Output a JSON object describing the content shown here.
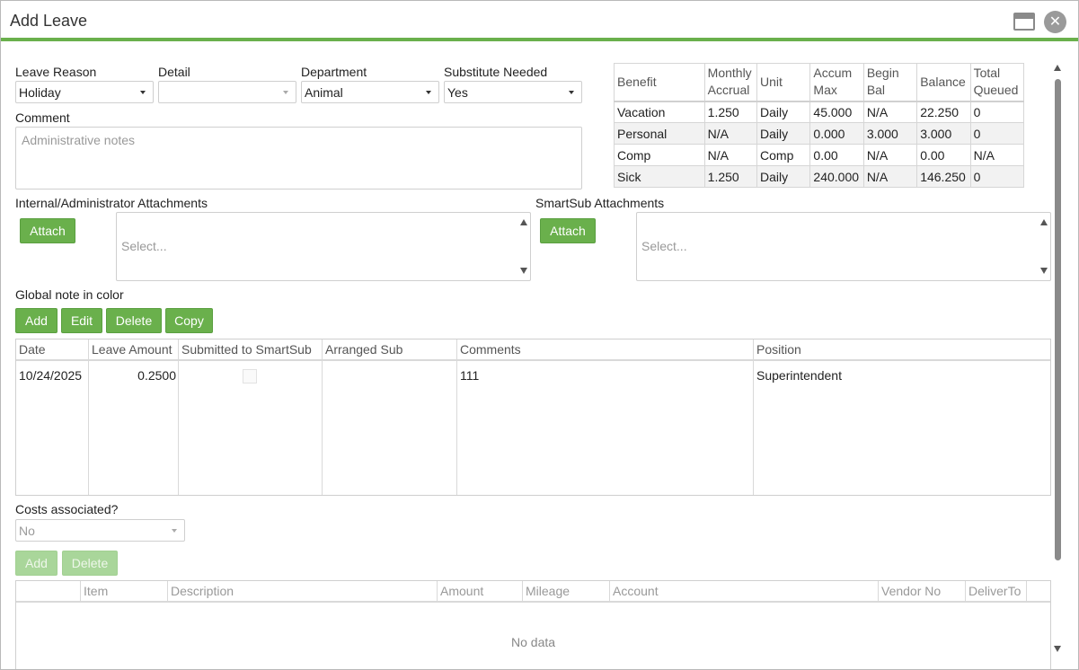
{
  "window": {
    "title": "Add Leave"
  },
  "form": {
    "leave_reason": {
      "label": "Leave Reason",
      "value": "Holiday"
    },
    "detail": {
      "label": "Detail",
      "value": ""
    },
    "department": {
      "label": "Department",
      "value": "Animal"
    },
    "substitute_needed": {
      "label": "Substitute Needed",
      "value": "Yes"
    },
    "comment": {
      "label": "Comment",
      "placeholder": "Administrative notes"
    }
  },
  "benefits": {
    "headers": [
      "Benefit",
      "Monthly Accrual",
      "Unit",
      "Accum Max",
      "Begin Bal",
      "Balance",
      "Total Queued"
    ],
    "rows": [
      [
        "Vacation",
        "1.250",
        "Daily",
        "45.000",
        "N/A",
        "22.250",
        "0"
      ],
      [
        "Personal",
        "N/A",
        "Daily",
        "0.000",
        "3.000",
        "3.000",
        "0"
      ],
      [
        "Comp",
        "N/A",
        "Comp",
        "0.00",
        "N/A",
        "0.00",
        "N/A"
      ],
      [
        "Sick",
        "1.250",
        "Daily",
        "240.000",
        "N/A",
        "146.250",
        "0"
      ]
    ]
  },
  "attachments": {
    "internal": {
      "label": "Internal/Administrator Attachments",
      "button": "Attach",
      "placeholder": "Select..."
    },
    "smartsub": {
      "label": "SmartSub Attachments",
      "button": "Attach",
      "placeholder": "Select..."
    }
  },
  "global_note": {
    "label": "Global note in color",
    "buttons": {
      "add": "Add",
      "edit": "Edit",
      "delete": "Delete",
      "copy": "Copy"
    }
  },
  "leave_grid": {
    "headers": [
      "Date",
      "Leave Amount",
      "Submitted to SmartSub",
      "Arranged Sub",
      "Comments",
      "Position"
    ],
    "rows": [
      {
        "date": "10/24/2025",
        "leave_amount": "0.2500",
        "submitted": false,
        "arranged_sub": "",
        "comments": "111",
        "position": "Superintendent"
      }
    ]
  },
  "costs": {
    "label": "Costs associated?",
    "value": "No",
    "buttons": {
      "add": "Add",
      "delete": "Delete"
    },
    "headers": [
      "",
      "Item",
      "Description",
      "Amount",
      "Mileage",
      "Account",
      "Vendor No",
      "DeliverTo"
    ],
    "empty_text": "No data"
  },
  "colors": {
    "accent": "#6ab04c"
  },
  "icons": {
    "maximize": "maximize-icon",
    "close": "close-icon"
  }
}
